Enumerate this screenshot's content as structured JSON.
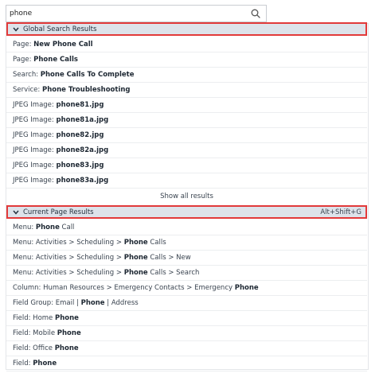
{
  "search": {
    "value": "phone",
    "placeholder": ""
  },
  "global": {
    "header": "Global Search Results",
    "items": [
      {
        "prefix": "Page: ",
        "bold": "New Phone Call",
        "suffix": ""
      },
      {
        "prefix": "Page: ",
        "bold": "Phone Calls",
        "suffix": ""
      },
      {
        "prefix": "Search: ",
        "bold": "Phone Calls To Complete",
        "suffix": ""
      },
      {
        "prefix": "Service: ",
        "bold": "Phone Troubleshooting",
        "suffix": ""
      },
      {
        "prefix": "JPEG Image: ",
        "bold": "phone81.jpg",
        "suffix": ""
      },
      {
        "prefix": "JPEG Image: ",
        "bold": "phone81a.jpg",
        "suffix": ""
      },
      {
        "prefix": "JPEG Image: ",
        "bold": "phone82.jpg",
        "suffix": ""
      },
      {
        "prefix": "JPEG Image: ",
        "bold": "phone82a.jpg",
        "suffix": ""
      },
      {
        "prefix": "JPEG Image: ",
        "bold": "phone83.jpg",
        "suffix": ""
      },
      {
        "prefix": "JPEG Image: ",
        "bold": "phone83a.jpg",
        "suffix": ""
      }
    ],
    "show_all": "Show all results"
  },
  "current": {
    "header": "Current Page Results",
    "shortcut": "Alt+Shift+G",
    "items": [
      {
        "prefix": "Menu:  ",
        "bold": "Phone",
        "suffix": " Call"
      },
      {
        "prefix": "Menu:  Activities > Scheduling > ",
        "bold": "Phone",
        "suffix": " Calls"
      },
      {
        "prefix": "Menu:  Activities > Scheduling > ",
        "bold": "Phone",
        "suffix": " Calls > New"
      },
      {
        "prefix": "Menu:  Activities > Scheduling > ",
        "bold": "Phone",
        "suffix": " Calls > Search"
      },
      {
        "prefix": "Column:  Human Resources > Emergency Contacts > Emergency ",
        "bold": "Phone",
        "suffix": ""
      },
      {
        "prefix": "Field Group:  Email | ",
        "bold": "Phone",
        "suffix": " | Address"
      },
      {
        "prefix": "Field:  Home ",
        "bold": "Phone",
        "suffix": ""
      },
      {
        "prefix": "Field:  Mobile ",
        "bold": "Phone",
        "suffix": ""
      },
      {
        "prefix": "Field:  Office ",
        "bold": "Phone",
        "suffix": ""
      },
      {
        "prefix": "Field:  ",
        "bold": "Phone",
        "suffix": ""
      }
    ]
  }
}
